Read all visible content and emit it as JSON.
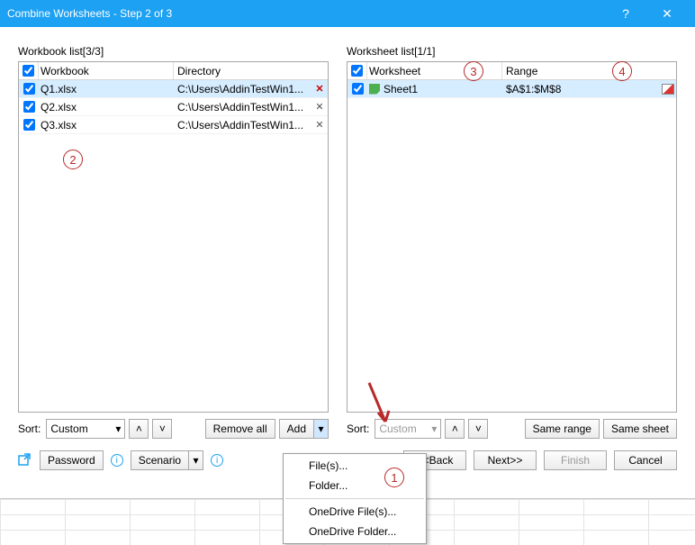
{
  "window": {
    "title": "Combine Worksheets - Step 2 of 3",
    "help": "?",
    "close": "✕"
  },
  "workbook": {
    "label": "Workbook list[3/3]",
    "col_name": "Workbook",
    "col_dir": "Directory",
    "rows": [
      {
        "name": "Q1.xlsx",
        "dir": "C:\\Users\\AddinTestWin1..."
      },
      {
        "name": "Q2.xlsx",
        "dir": "C:\\Users\\AddinTestWin1..."
      },
      {
        "name": "Q3.xlsx",
        "dir": "C:\\Users\\AddinTestWin1..."
      }
    ]
  },
  "worksheet": {
    "label": "Worksheet list[1/1]",
    "col_name": "Worksheet",
    "col_range": "Range",
    "rows": [
      {
        "name": "Sheet1",
        "range": "$A$1:$M$8"
      }
    ]
  },
  "sort": {
    "label": "Sort:",
    "value": "Custom"
  },
  "buttons": {
    "remove_all": "Remove all",
    "add": "Add",
    "same_range": "Same range",
    "same_sheet": "Same sheet",
    "password": "Password",
    "scenario": "Scenario",
    "back": "<<Back",
    "next": "Next>>",
    "finish": "Finish",
    "cancel": "Cancel"
  },
  "add_menu": {
    "files": "File(s)...",
    "folder": "Folder...",
    "od_files": "OneDrive File(s)...",
    "od_folder": "OneDrive Folder..."
  },
  "annotations": {
    "n1": "1",
    "n2": "2",
    "n3": "3",
    "n4": "4"
  }
}
